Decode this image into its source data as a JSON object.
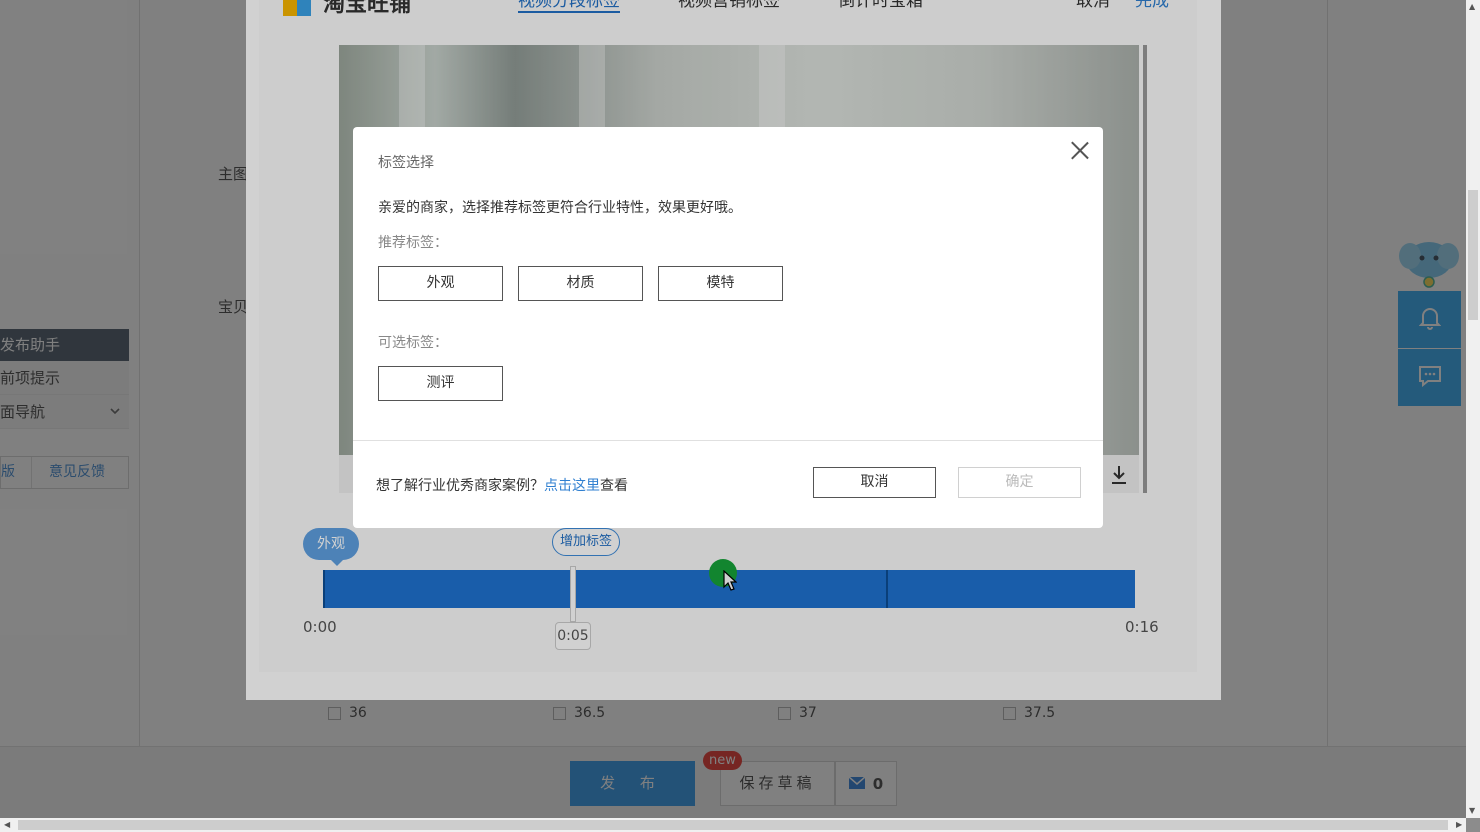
{
  "background": {
    "labels": [
      "主图",
      "宝贝"
    ],
    "helper": {
      "title": "发布助手",
      "items": [
        {
          "label": "前项提示",
          "chevron": false
        },
        {
          "label": "面导航",
          "chevron": true
        }
      ],
      "links": [
        "版",
        "意见反馈"
      ]
    },
    "sizes": [
      "36",
      "36.5",
      "37",
      "37.5"
    ],
    "bottom": {
      "publish_label": "发 布",
      "draft_label": "保存草稿",
      "new_badge": "new",
      "mail_count": "0"
    }
  },
  "editor": {
    "logo": "淘宝旺铺",
    "tabs": [
      {
        "label": "视频分段标签",
        "active": true
      },
      {
        "label": "视频营销标签",
        "active": false
      },
      {
        "label": "倒计时宝箱",
        "active": false
      }
    ],
    "cancel_label": "取消",
    "done_label": "完成",
    "timeline": {
      "segment_tag": "外观",
      "add_tag_label": "增加标签",
      "start_time": "0:00",
      "end_time": "0:16",
      "playhead_time": "0:05"
    }
  },
  "dialog": {
    "title": "标签选择",
    "intro": "亲爱的商家，选择推荐标签更符合行业特性，效果更好哦。",
    "recommended_label": "推荐标签：",
    "recommended_tags": [
      "外观",
      "材质",
      "模特"
    ],
    "optional_label": "可选标签：",
    "optional_tags": [
      "测评"
    ],
    "footer": {
      "prefix": "想了解行业优秀商家案例？",
      "link": "点击这里",
      "suffix": "查看"
    },
    "cancel_label": "取消",
    "confirm_label": "确定"
  },
  "colors": {
    "accent": "#2170c5",
    "timeline": "#1f72d0",
    "publish": "#1a8ce8",
    "float_widget": "#1da1f2",
    "badge": "#e4231b"
  },
  "icons": [
    "close-icon",
    "play-icon",
    "download-icon",
    "bell-icon",
    "chat-icon",
    "mail-icon",
    "chevron-down-icon",
    "mouse-cursor-icon"
  ]
}
